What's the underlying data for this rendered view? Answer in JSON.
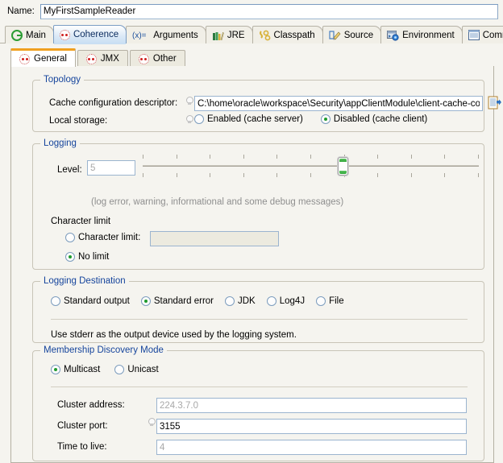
{
  "name_row": {
    "label": "Name:",
    "value": "MyFirstSampleReader"
  },
  "outer_tabs": [
    {
      "label": "Main",
      "icon": "green-circle-g-icon",
      "selected": false
    },
    {
      "label": "Coherence",
      "icon": "coherence-dots-icon",
      "selected": true
    },
    {
      "label": "Arguments",
      "icon": "variable-x-icon",
      "selected": false
    },
    {
      "label": "JRE",
      "icon": "jre-books-icon",
      "selected": false
    },
    {
      "label": "Classpath",
      "icon": "classpath-icon",
      "selected": false
    },
    {
      "label": "Source",
      "icon": "source-pencil-icon",
      "selected": false
    },
    {
      "label": "Environment",
      "icon": "environment-icon",
      "selected": false
    },
    {
      "label": "Common",
      "icon": "common-list-icon",
      "selected": false
    }
  ],
  "inner_tabs": [
    {
      "label": "General",
      "icon": "coherence-dots-icon",
      "selected": true
    },
    {
      "label": "JMX",
      "icon": "coherence-dots-icon",
      "selected": false
    },
    {
      "label": "Other",
      "icon": "coherence-dots-icon",
      "selected": false
    }
  ],
  "topology": {
    "legend": "Topology",
    "descriptor_label": "Cache configuration descriptor:",
    "descriptor_value": "C:\\home\\oracle\\workspace\\Security\\appClientModule\\client-cache-config",
    "browse_icon": "browse-file-icon",
    "local_storage_label": "Local storage:",
    "local_storage_options": [
      {
        "label": "Enabled (cache server)",
        "selected": false
      },
      {
        "label": "Disabled (cache client)",
        "selected": true
      }
    ]
  },
  "logging": {
    "legend": "Logging",
    "level_label": "Level:",
    "level_value": "5",
    "level_min": 0,
    "level_max": 10,
    "level_tick_count": 11,
    "hint": "(log error, warning, informational and some debug messages)",
    "character_limit_heading": "Character limit",
    "character_limit_option": {
      "label": "Character limit:",
      "selected": false
    },
    "character_limit_value": "",
    "no_limit_option": {
      "label": "No limit",
      "selected": true
    }
  },
  "logging_destination": {
    "legend": "Logging Destination",
    "options": [
      {
        "label": "Standard output",
        "selected": false
      },
      {
        "label": "Standard error",
        "selected": true
      },
      {
        "label": "JDK",
        "selected": false
      },
      {
        "label": "Log4J",
        "selected": false
      },
      {
        "label": "File",
        "selected": false
      }
    ],
    "description": "Use stderr as the output device used by the logging system."
  },
  "membership": {
    "legend": "Membership Discovery Mode",
    "modes": [
      {
        "label": "Multicast",
        "selected": true
      },
      {
        "label": "Unicast",
        "selected": false
      }
    ],
    "fields": [
      {
        "label": "Cluster address:",
        "value": "224.3.7.0",
        "ghost": true,
        "has_bulb": false
      },
      {
        "label": "Cluster port:",
        "value": "3155",
        "ghost": false,
        "has_bulb": true
      },
      {
        "label": "Time to live:",
        "value": "4",
        "ghost": true,
        "has_bulb": false
      }
    ]
  },
  "colors": {
    "legend_blue": "#15449c",
    "radio_green": "#1f9b2e",
    "tab_accent_orange": "#f0a020",
    "background": "#f5f4ef"
  }
}
